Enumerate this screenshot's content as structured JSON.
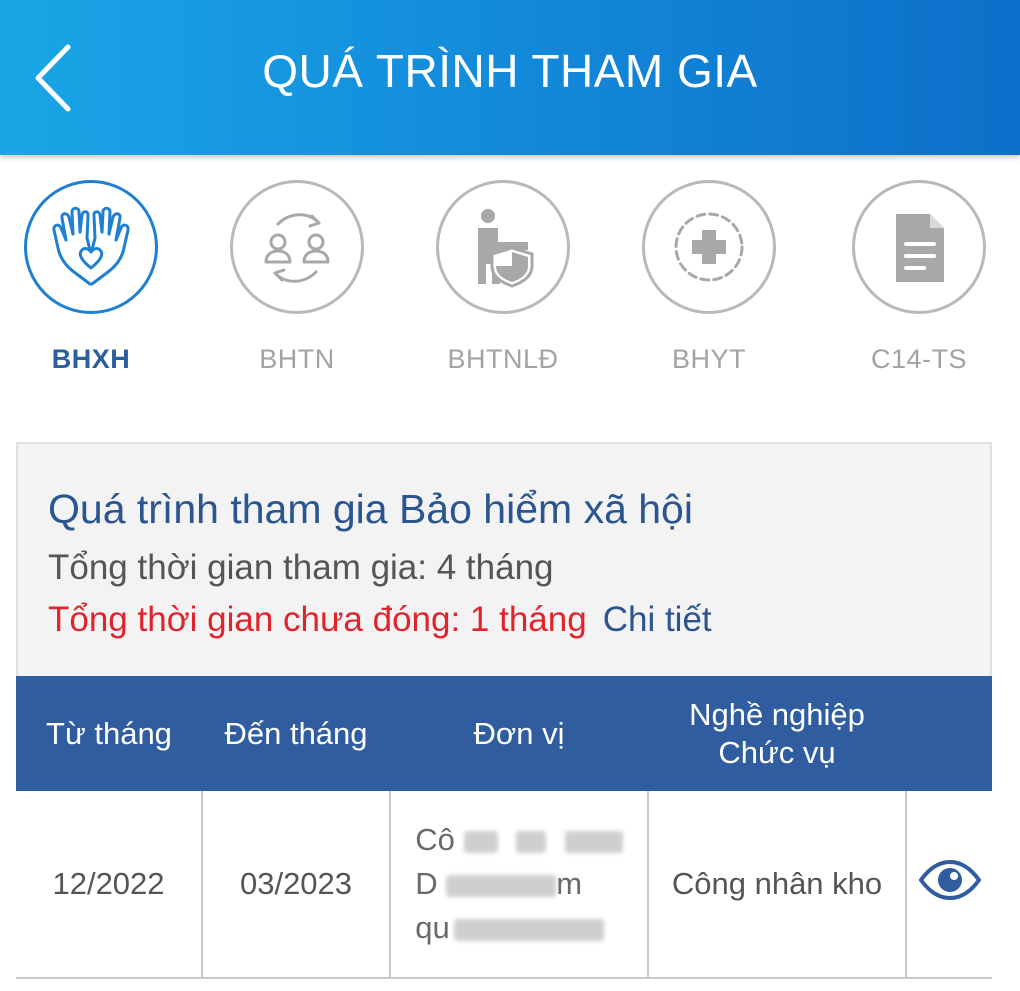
{
  "header": {
    "title": "QUÁ TRÌNH THAM GIA"
  },
  "tabs": [
    {
      "label": "BHXH",
      "icon": "hands-heart-icon",
      "active": true
    },
    {
      "label": "BHTN",
      "icon": "people-exchange-icon",
      "active": false
    },
    {
      "label": "BHTNLĐ",
      "icon": "worker-shield-icon",
      "active": false
    },
    {
      "label": "BHYT",
      "icon": "medical-cross-icon",
      "active": false
    },
    {
      "label": "C14-TS",
      "icon": "document-icon",
      "active": false
    }
  ],
  "summary": {
    "title": "Quá trình tham gia Bảo hiểm xã hội",
    "total": "Tổng thời gian tham gia: 4 tháng",
    "unpaid": "Tổng thời gian chưa đóng: 1 tháng",
    "detail_link": "Chi tiết"
  },
  "table": {
    "headers": {
      "from": "Từ tháng",
      "to": "Đến tháng",
      "unit": "Đơn vị",
      "job_line1": "Nghề nghiệp",
      "job_line2": "Chức vụ"
    },
    "rows": [
      {
        "from": "12/2022",
        "to": "03/2023",
        "unit_l1": "Cô",
        "unit_l2": "D",
        "unit_l2b": "m",
        "unit_l3": "qu",
        "job": "Công nhân kho"
      }
    ]
  },
  "colors": {
    "header": "#1287d8",
    "active": "#1f7fd0",
    "table_header": "#2f5da0",
    "unpaid": "#e0242c"
  }
}
